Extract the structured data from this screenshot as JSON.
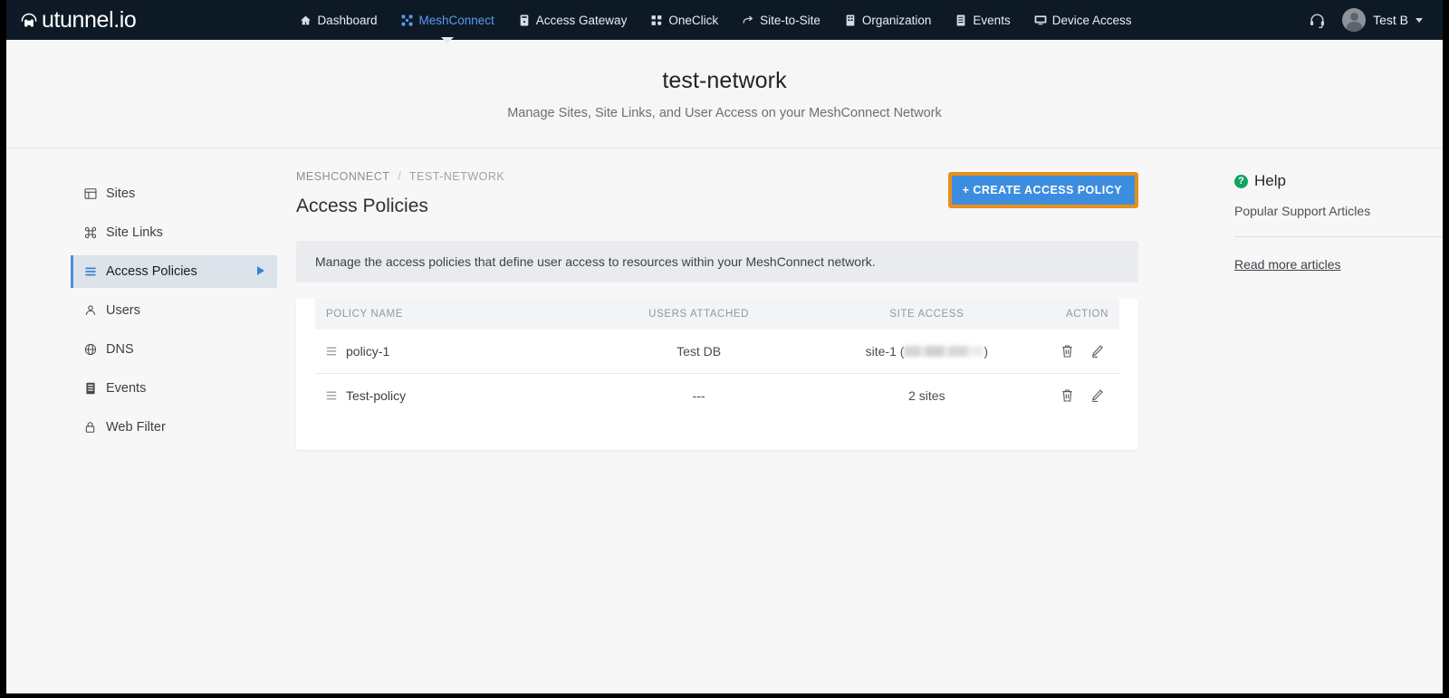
{
  "topnav": {
    "brand": "utunnel.io",
    "items": [
      {
        "label": "Dashboard",
        "icon": "home-icon",
        "active": false
      },
      {
        "label": "MeshConnect",
        "icon": "mesh-icon",
        "active": true
      },
      {
        "label": "Access Gateway",
        "icon": "gateway-icon",
        "active": false
      },
      {
        "label": "OneClick",
        "icon": "oneclick-icon",
        "active": false
      },
      {
        "label": "Site-to-Site",
        "icon": "site-to-site-icon",
        "active": false
      },
      {
        "label": "Organization",
        "icon": "organization-icon",
        "active": false
      },
      {
        "label": "Events",
        "icon": "events-icon",
        "active": false
      },
      {
        "label": "Device Access",
        "icon": "device-access-icon",
        "active": false
      }
    ],
    "support_icon": "headset-icon",
    "user": "Test B"
  },
  "hero": {
    "title": "test-network",
    "subtitle": "Manage Sites, Site Links, and User Access on your MeshConnect Network"
  },
  "sidebar": {
    "items": [
      {
        "label": "Sites",
        "icon": "sites-icon",
        "active": false
      },
      {
        "label": "Site Links",
        "icon": "site-links-icon",
        "active": false
      },
      {
        "label": "Access Policies",
        "icon": "access-policies-icon",
        "active": true
      },
      {
        "label": "Users",
        "icon": "users-icon",
        "active": false
      },
      {
        "label": "DNS",
        "icon": "dns-globe-icon",
        "active": false
      },
      {
        "label": "Events",
        "icon": "events-icon",
        "active": false
      },
      {
        "label": "Web Filter",
        "icon": "lock-icon",
        "active": false
      }
    ]
  },
  "main": {
    "breadcrumb": {
      "root": "MESHCONNECT",
      "separator": "/",
      "current": "TEST-NETWORK"
    },
    "page_title": "Access Policies",
    "create_button": "+ CREATE ACCESS POLICY",
    "info_banner": "Manage the access policies that define user access to resources within your MeshConnect network.",
    "table": {
      "columns": [
        "POLICY NAME",
        "USERS ATTACHED",
        "SITE ACCESS",
        "ACTION"
      ],
      "rows": [
        {
          "policy_name": "policy-1",
          "users_attached": "Test DB",
          "site_access_prefix": "site-1 (",
          "site_access_redacted": true,
          "site_access_suffix": ")",
          "delete_icon": "trash-icon",
          "edit_icon": "pencil-icon"
        },
        {
          "policy_name": "Test-policy",
          "users_attached": "---",
          "site_access_prefix": "2 sites",
          "site_access_redacted": false,
          "site_access_suffix": "",
          "delete_icon": "trash-icon",
          "edit_icon": "pencil-icon"
        }
      ]
    }
  },
  "help": {
    "title": "Help",
    "subtitle": "Popular Support Articles",
    "link": "Read more articles"
  },
  "colors": {
    "navbar_bg": "#0d1a26",
    "accent_blue": "#3d8ddf",
    "active_nav_blue": "#5b9bf0",
    "annotation_orange": "#e8901a",
    "help_green": "#13a463",
    "page_bg": "#f7f7f8"
  }
}
